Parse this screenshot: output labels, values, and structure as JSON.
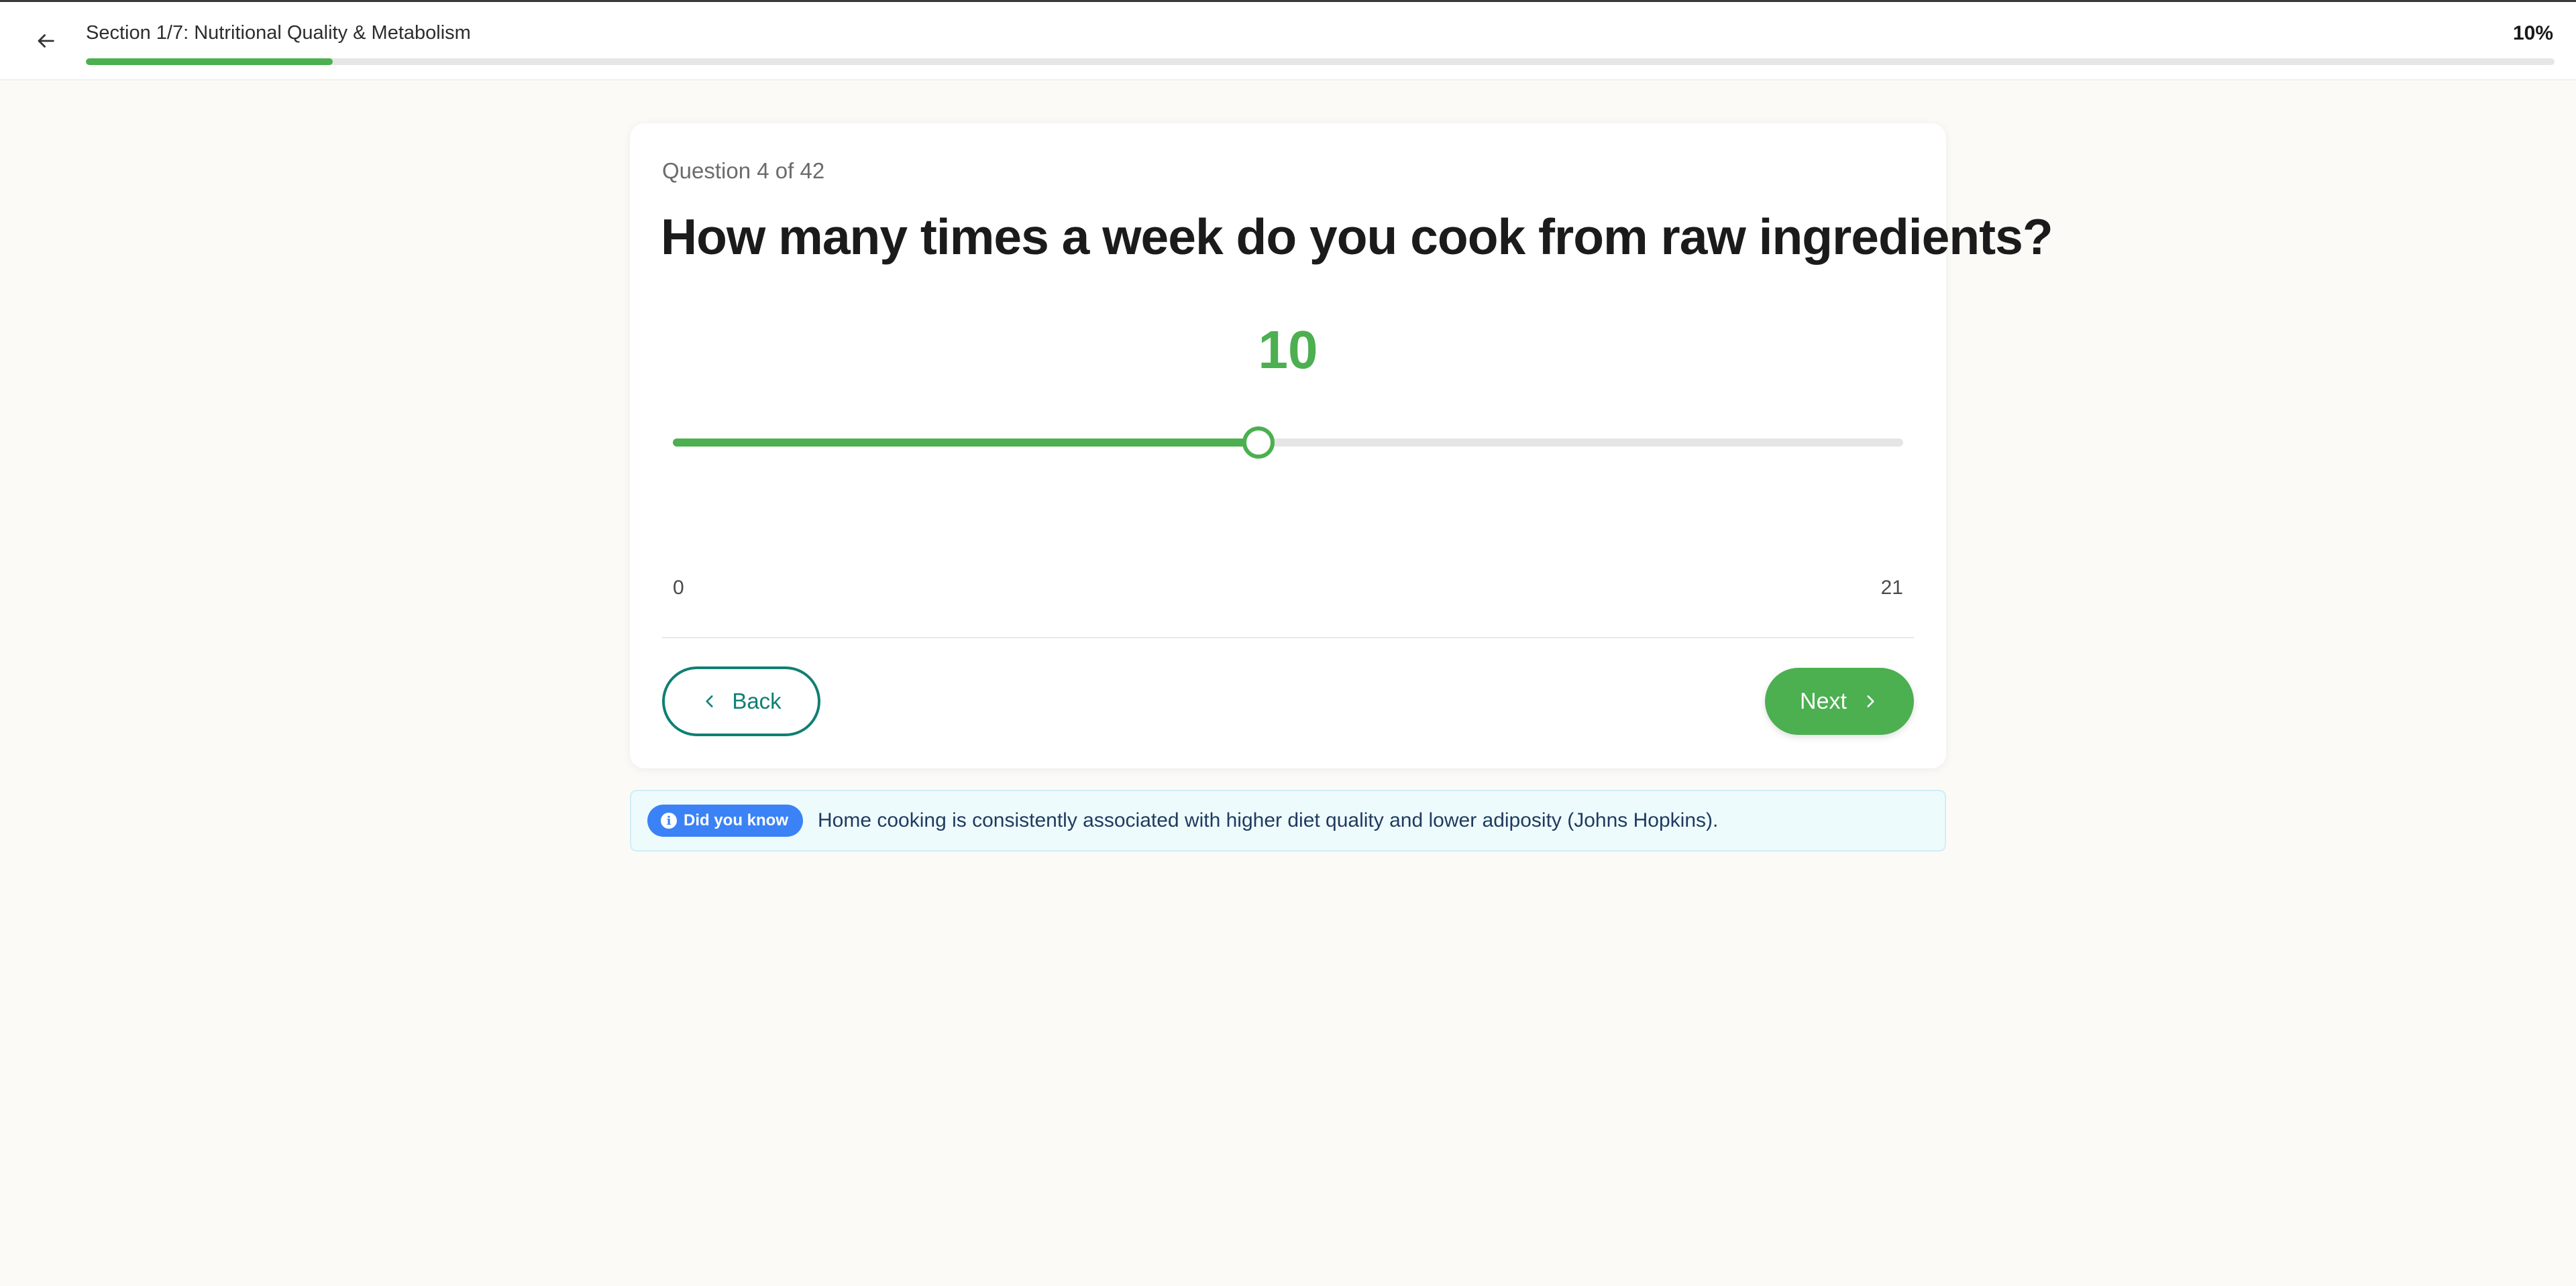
{
  "header": {
    "section_title": "Section 1/7: Nutritional Quality & Metabolism",
    "percent_label": "10%",
    "progress_fraction": 0.1
  },
  "question": {
    "counter": "Question 4 of 42",
    "title": "How many times a week do you cook from raw ingredients?"
  },
  "slider": {
    "value": 10,
    "min": 0,
    "max": 21,
    "value_label": "10",
    "min_label": "0",
    "max_label": "21",
    "accent_color": "#4caf50"
  },
  "nav": {
    "back_label": "Back",
    "next_label": "Next"
  },
  "info": {
    "badge_label": "Did you know",
    "badge_icon": "info-icon",
    "text": "Home cooking is consistently associated with higher diet quality and lower adiposity (Johns Hopkins)."
  },
  "colors": {
    "accent_green": "#4caf50",
    "teal": "#0f7f73",
    "badge_blue": "#3b82f6"
  }
}
